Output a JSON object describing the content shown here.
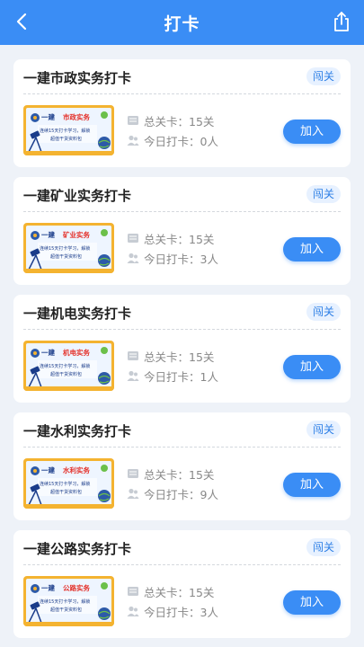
{
  "header": {
    "title": "打卡",
    "back_icon": "back-chevron-icon",
    "share_icon": "share-icon"
  },
  "banner_text": {
    "prefix": "一建",
    "line1": "连续15天打卡学习，解锁",
    "line2": "超值干货资料包"
  },
  "labels": {
    "total_prefix": "总关卡：",
    "today_prefix": "今日打卡：",
    "join": "加入",
    "tag": "闯关"
  },
  "cards": [
    {
      "title": "一建市政实务打卡",
      "subject": "市政实务",
      "total": "15关",
      "today": "0人"
    },
    {
      "title": "一建矿业实务打卡",
      "subject": "矿业实务",
      "total": "15关",
      "today": "3人"
    },
    {
      "title": "一建机电实务打卡",
      "subject": "机电实务",
      "total": "15关",
      "today": "1人"
    },
    {
      "title": "一建水利实务打卡",
      "subject": "水利实务",
      "total": "15关",
      "today": "9人"
    },
    {
      "title": "一建公路实务打卡",
      "subject": "公路实务",
      "total": "15关",
      "today": "3人"
    }
  ],
  "colors": {
    "accent": "#3a8df5",
    "banner_bg": "#f4b330",
    "banner_inner": "#eef5ff",
    "subject_red": "#e4322b"
  }
}
